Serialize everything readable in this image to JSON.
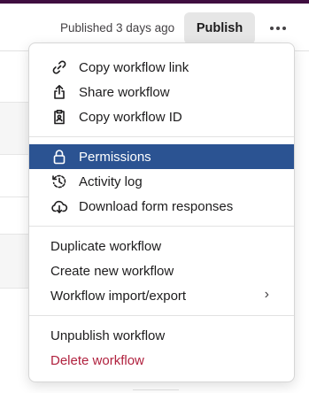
{
  "header": {
    "published_text": "Published 3 days ago",
    "publish_label": "Publish"
  },
  "menu": {
    "group1": [
      {
        "label": "Copy workflow link",
        "icon": "link-icon"
      },
      {
        "label": "Share workflow",
        "icon": "share-icon"
      },
      {
        "label": "Copy workflow ID",
        "icon": "clipboard-icon"
      }
    ],
    "group2": [
      {
        "label": "Permissions",
        "icon": "lock-icon",
        "active": true
      },
      {
        "label": "Activity log",
        "icon": "history-icon"
      },
      {
        "label": "Download form responses",
        "icon": "cloud-download-icon"
      }
    ],
    "group3": [
      {
        "label": "Duplicate workflow"
      },
      {
        "label": "Create new workflow"
      },
      {
        "label": "Workflow import/export",
        "has_submenu": true,
        "chevron": "›"
      }
    ],
    "group4": [
      {
        "label": "Unpublish workflow"
      },
      {
        "label": "Delete workflow",
        "danger": true
      }
    ]
  },
  "colors": {
    "active_bg": "#2b5392",
    "danger_text": "#b0213e",
    "publish_bg": "#e6e6e6"
  }
}
